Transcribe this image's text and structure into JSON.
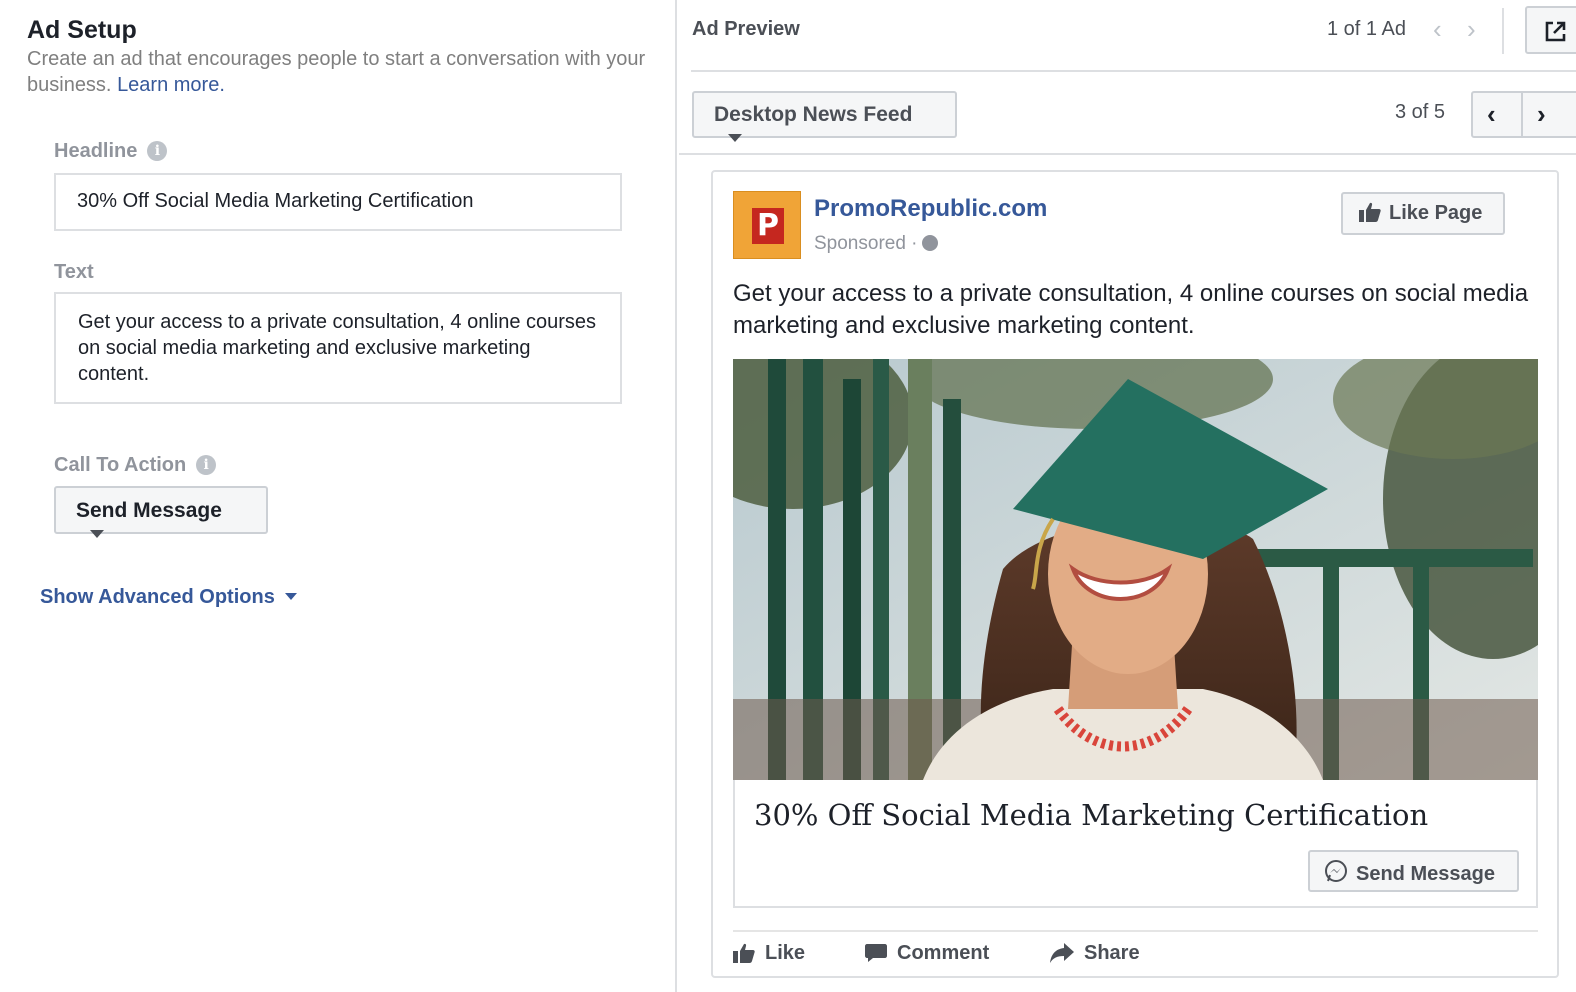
{
  "setup": {
    "title": "Ad Setup",
    "description": "Create an ad that encourages people to start a conversation with your business.",
    "learn_more": "Learn more.",
    "headline_label": "Headline",
    "headline_value": "30% Off Social Media Marketing Certification",
    "text_label": "Text",
    "text_value": "Get your access to a private consultation, 4 online courses on social media marketing and exclusive marketing content.",
    "cta_label": "Call To Action",
    "cta_value": "Send Message",
    "advanced_link": "Show Advanced Options"
  },
  "preview": {
    "title": "Ad Preview",
    "ad_count": "1 of 1 Ad",
    "placement": "Desktop News Feed",
    "placement_count": "3 of 5"
  },
  "ad": {
    "page_name": "PromoRepublic.com",
    "logo_letter": "P",
    "sponsored": "Sponsored ·",
    "like_page": "Like Page",
    "body": "Get your access to a private consultation, 4 online courses on social media marketing and exclusive marketing content.",
    "image_alt": "graduate-photo",
    "headline": "30% Off Social Media Marketing Certification",
    "cta": "Send Message",
    "actions": {
      "like": "Like",
      "comment": "Comment",
      "share": "Share"
    }
  },
  "colors": {
    "link_blue": "#365899",
    "border": "#dddfe2",
    "button_bg": "#f5f6f7",
    "logo_orange": "#f0a437",
    "logo_red": "#c5271f"
  },
  "icons": [
    "info-icon",
    "chevron-left-icon",
    "chevron-right-icon",
    "external-link-icon",
    "caret-down-icon",
    "thumbs-up-icon",
    "globe-icon",
    "messenger-icon",
    "comment-icon",
    "share-icon"
  ]
}
